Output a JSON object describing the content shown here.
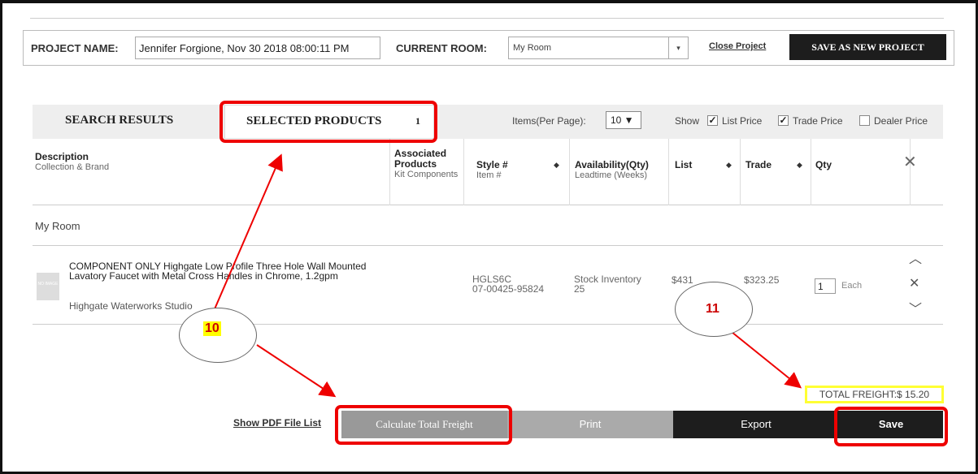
{
  "project_bar": {
    "project_name_label": "PROJECT NAME:",
    "project_name_value": "Jennifer Forgione, Nov 30 2018 08:00:11 PM",
    "current_room_label": "CURRENT ROOM:",
    "current_room_value": "My Room",
    "close_project": "Close Project",
    "save_as_new": "SAVE AS NEW PROJECT"
  },
  "tabs": {
    "search_results": "SEARCH RESULTS",
    "selected_products": "SELECTED PRODUCTS",
    "selected_count": "1"
  },
  "list_options": {
    "items_per_page_label": "Items(Per Page):",
    "items_per_page_value": "10 ▼",
    "show_label": "Show",
    "list_price": "List Price",
    "trade_price": "Trade Price",
    "dealer_price": "Dealer Price",
    "list_price_checked": true,
    "trade_price_checked": true,
    "dealer_price_checked": false
  },
  "table": {
    "headers": {
      "description": "Description",
      "description_sub": "Collection & Brand",
      "associated": "Associated Products",
      "associated_sub": "Kit Components",
      "style": "Style #",
      "style_sub": "Item #",
      "availability": "Availability(Qty)",
      "availability_sub": "Leadtime (Weeks)",
      "list": "List",
      "trade": "Trade",
      "qty": "Qty"
    },
    "room_name": "My Room",
    "rows": [
      {
        "thumb": "NO IMAGE",
        "description": "COMPONENT ONLY Highgate Low Profile Three Hole Wall Mounted Lavatory Faucet with Metal Cross Handles in Chrome, 1.2gpm",
        "brand": "Highgate  Waterworks Studio",
        "style": "HGLS6C",
        "item": "07-00425-95824",
        "availability": "Stock Inventory",
        "leadtime": "25",
        "list": "$431",
        "trade": "$323.25",
        "qty": "1",
        "unit": "Each"
      }
    ]
  },
  "footer": {
    "total_freight": "TOTAL FREIGHT:$ 15.20",
    "pdf_list": "Show PDF File List",
    "calculate": "Calculate Total Freight",
    "print": "Print",
    "export": "Export",
    "save": "Save"
  },
  "annotations": {
    "callout_10": "10",
    "callout_11": "11",
    "highlight_color": "#e00000"
  }
}
